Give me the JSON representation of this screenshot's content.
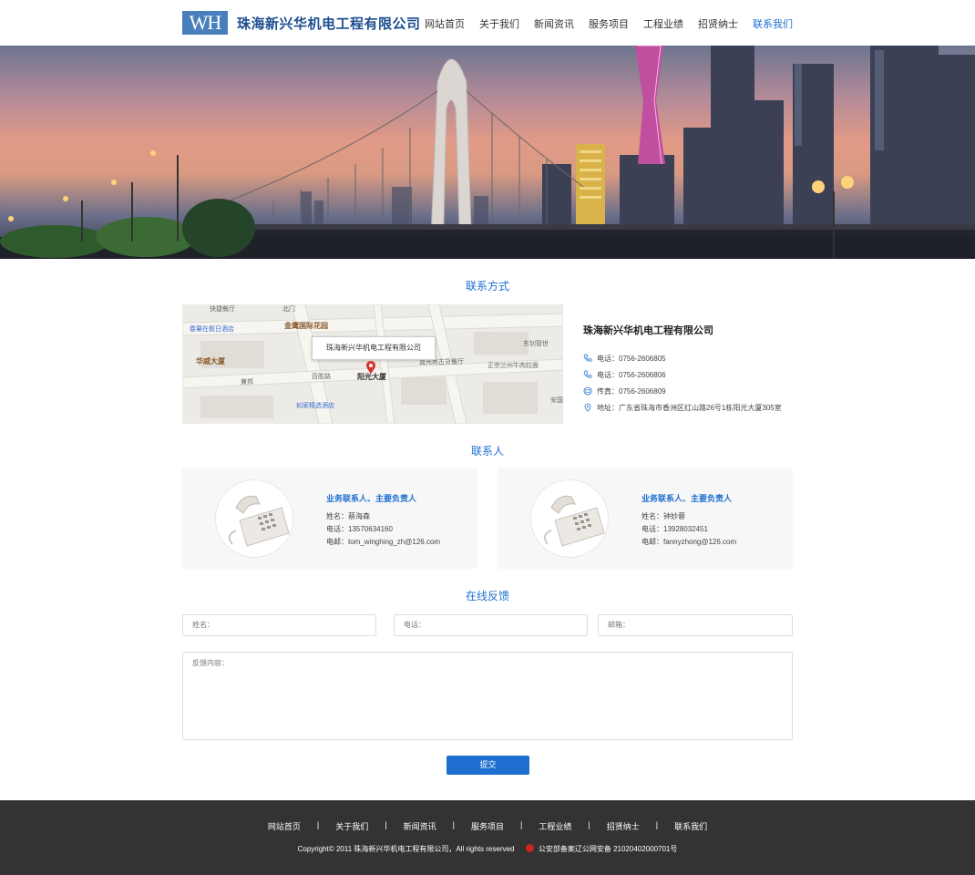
{
  "header": {
    "logo_mark": "WH",
    "company_name": "珠海新兴华机电工程有限公司",
    "nav": [
      {
        "label": "网站首页",
        "active": false
      },
      {
        "label": "关于我们",
        "active": false
      },
      {
        "label": "新闻资讯",
        "active": false
      },
      {
        "label": "服务项目",
        "active": false
      },
      {
        "label": "工程业绩",
        "active": false
      },
      {
        "label": "招贤纳士",
        "active": false
      },
      {
        "label": "联系我们",
        "active": true
      }
    ]
  },
  "contact_section": {
    "title": "联系方式",
    "map": {
      "popup": "珠海新兴华机电工程有限公司",
      "labels": {
        "park": "金鹰国际花园",
        "huawei": "华威大厦",
        "yangguang": "阳光大厦",
        "hotel1": "春粟在假日酒店",
        "hotel2": "如家精选酒店",
        "restaurant": "快捷餐厅",
        "north_gate": "北门",
        "dongfu": "东钊管世",
        "noodle": "正宗兰州牛肉拉面",
        "shop": "蓝光尚古货餐厅",
        "baishi": "百胜路",
        "jianbang": "兼邦",
        "anguo": "安国"
      }
    },
    "company_name": "珠海新兴华机电工程有限公司",
    "phone1": "电话：0756-2606805",
    "phone2": "电话：0756-2606806",
    "fax": "传真：0756-2606809",
    "address": "地址：广东省珠海市香洲区红山路26号1栋阳光大厦305室"
  },
  "people_section": {
    "title": "联系人",
    "contacts": [
      {
        "role": "业务联系人、主要负责人",
        "name": "姓名：蔡海森",
        "phone": "电话：13570634160",
        "email": "电邮：tom_winghing_zh@126.com"
      },
      {
        "role": "业务联系人、主要负责人",
        "name": "姓名：钟妙蓉",
        "phone": "电话：13928032451",
        "email": "电邮：fannyzhong@126.com"
      }
    ]
  },
  "feedback_section": {
    "title": "在线反馈",
    "name_placeholder": "姓名：",
    "phone_placeholder": "电话：",
    "email_placeholder": "邮箱：",
    "content_placeholder": "反馈内容：",
    "submit_label": "提交"
  },
  "footer": {
    "nav": [
      "网站首页",
      "关于我们",
      "新闻资讯",
      "服务项目",
      "工程业绩",
      "招贤纳士",
      "联系我们"
    ],
    "separator": "|",
    "copyright": "Copyright© 2011 珠海新兴华机电工程有限公司，All rights reserved",
    "icp": "公安部备案辽公网安备 21020402000701号"
  },
  "colors": {
    "accent": "#1f6fd1",
    "logo": "#4a7fbd",
    "footer_bg": "#333333"
  }
}
